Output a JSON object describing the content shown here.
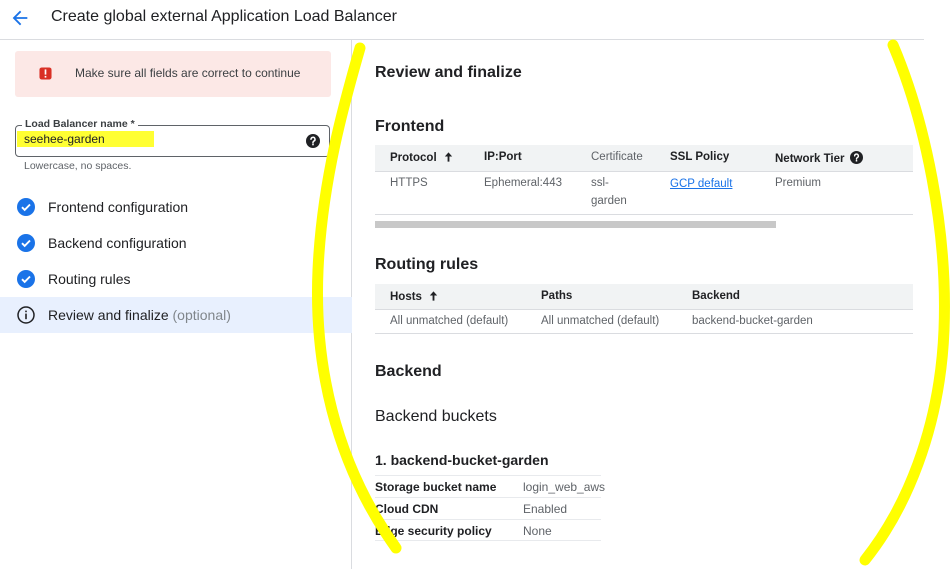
{
  "header": {
    "title": "Create global external Application Load Balancer"
  },
  "left_panel": {
    "error_message": "Make sure all fields are correct to continue",
    "lb_name": {
      "label": "Load Balancer name *",
      "value": "seehee-garden",
      "hint": "Lowercase, no spaces."
    },
    "steps": [
      {
        "label": "Frontend configuration",
        "suffix": "",
        "status": "complete"
      },
      {
        "label": "Backend configuration",
        "suffix": "",
        "status": "complete"
      },
      {
        "label": "Routing rules",
        "suffix": "",
        "status": "complete"
      },
      {
        "label": "Review and finalize",
        "suffix": "(optional)",
        "status": "current"
      }
    ]
  },
  "review": {
    "title": "Review and finalize",
    "frontend": {
      "title": "Frontend",
      "columns": [
        "Protocol",
        "IP:Port",
        "Certificate",
        "SSL Policy",
        "Network Tier"
      ],
      "row": {
        "protocol": "HTTPS",
        "ip_port": "Ephemeral:443",
        "certificate_1": "ssl-",
        "certificate_2": "garden",
        "ssl_policy": "GCP default",
        "network_tier": "Premium"
      }
    },
    "routing": {
      "title": "Routing rules",
      "columns": [
        "Hosts",
        "Paths",
        "Backend"
      ],
      "row": {
        "hosts": "All unmatched (default)",
        "paths": "All unmatched (default)",
        "backend": "backend-bucket-garden"
      }
    },
    "backend": {
      "title": "Backend",
      "buckets_title": "Backend buckets",
      "item_title": "1. backend-bucket-garden",
      "props": [
        {
          "key": "Storage bucket name",
          "value": "login_web_aws"
        },
        {
          "key": "Cloud CDN",
          "value": "Enabled"
        },
        {
          "key": "Edge security policy",
          "value": "None"
        }
      ]
    }
  },
  "colors": {
    "accent": "#1a73e8",
    "error": "#d93025",
    "error_bg": "#fce8e6",
    "highlight": "#ffff33",
    "annotation": "#ffff00"
  }
}
